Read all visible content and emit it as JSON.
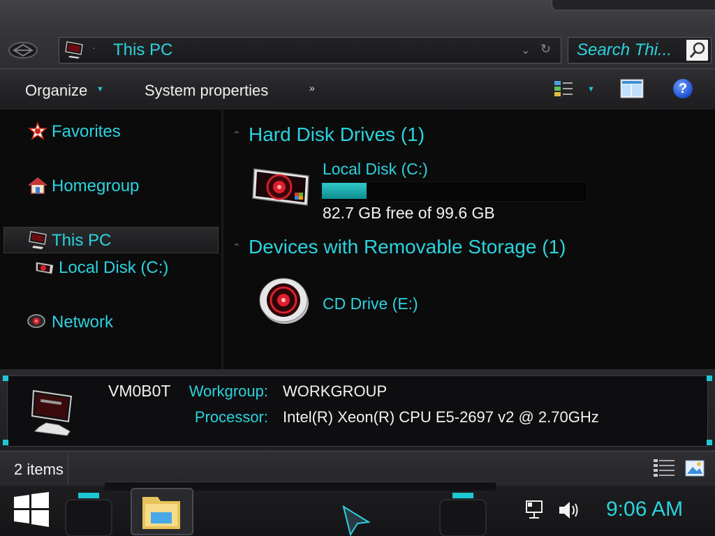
{
  "window": {
    "address": {
      "path": "This PC"
    },
    "search": {
      "placeholder": "Search Thi..."
    },
    "toolbar": {
      "organize_label": "Organize",
      "system_properties_label": "System properties",
      "more_label": "»"
    },
    "navigation": {
      "items": [
        {
          "label": "Favorites",
          "icon": "favorites-star-icon"
        },
        {
          "label": "Homegroup",
          "icon": "homegroup-house-icon"
        },
        {
          "label": "This PC",
          "icon": "computer-icon",
          "selected": true
        },
        {
          "label": "Local Disk (C:)",
          "icon": "hard-disk-icon"
        },
        {
          "label": "Network",
          "icon": "network-icon"
        }
      ]
    },
    "content": {
      "groups": [
        {
          "title": "Hard Disk Drives (1)",
          "items": [
            {
              "name": "Local Disk (C:)",
              "free_text": "82.7 GB free of 99.6 GB",
              "used_fraction": 0.17
            }
          ]
        },
        {
          "title": "Devices with Removable Storage (1)",
          "items": [
            {
              "name": "CD Drive (E:)"
            }
          ]
        }
      ]
    },
    "details": {
      "computer_name": "VM0B0T",
      "workgroup_label": "Workgroup:",
      "workgroup_value": "WORKGROUP",
      "processor_label": "Processor:",
      "processor_value": "Intel(R) Xeon(R) CPU E5-2697 v2 @ 2.70GHz"
    },
    "status": {
      "items_count": "2 items"
    }
  },
  "taskbar": {
    "time": "9:06 AM"
  },
  "colors": {
    "accent": "#2bd3de",
    "background": "#0b0b0c",
    "chrome": "#2c2c30"
  }
}
